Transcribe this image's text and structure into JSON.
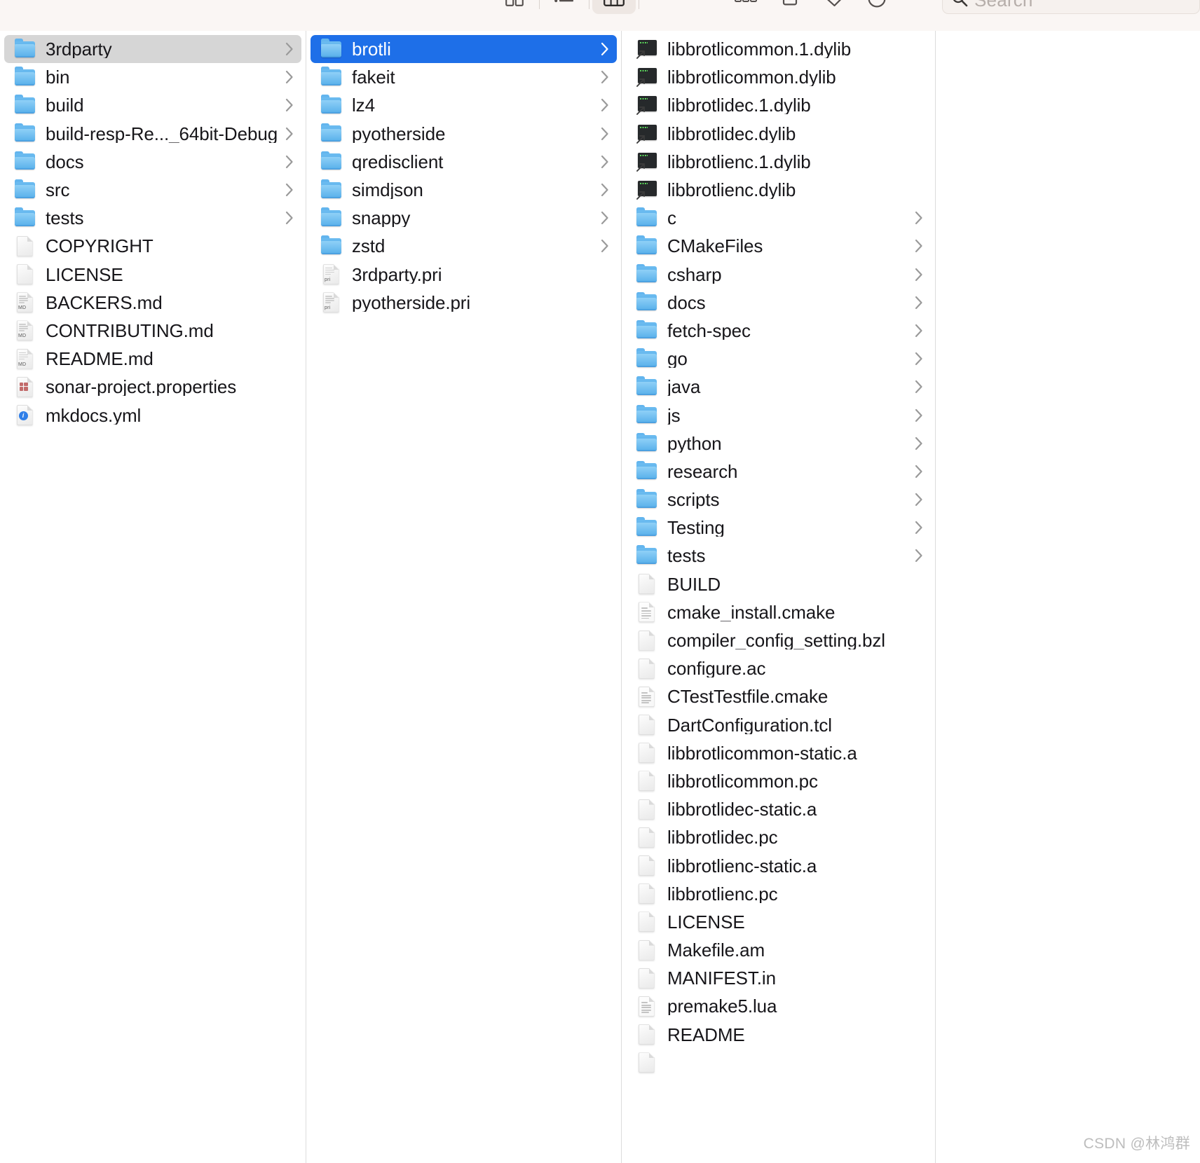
{
  "toolbar": {
    "buttons": [
      {
        "name": "icon-view-button",
        "icon": "grid-icon",
        "active": false
      },
      {
        "name": "list-view-button",
        "icon": "list-icon",
        "active": false
      },
      {
        "name": "column-view-button",
        "icon": "columns-icon",
        "active": true
      },
      {
        "name": "gallery-view-button",
        "icon": "gallery-icon",
        "active": false
      },
      {
        "name": "group-by-button",
        "icon": "group-icon",
        "active": false
      },
      {
        "name": "share-button",
        "icon": "share-icon",
        "active": false
      },
      {
        "name": "tags-button",
        "icon": "tag-icon",
        "active": false
      },
      {
        "name": "action-button",
        "icon": "more-circle-icon",
        "active": false
      }
    ],
    "search": {
      "placeholder": "Search",
      "value": "",
      "icon": "search-icon"
    }
  },
  "columns": [
    {
      "name": "column-1",
      "items": [
        {
          "label": "3rdparty",
          "icon": "folder",
          "chevron": true,
          "selected": "gray"
        },
        {
          "label": "bin",
          "icon": "folder",
          "chevron": true
        },
        {
          "label": "build",
          "icon": "folder",
          "chevron": true
        },
        {
          "label": "build-resp-Re..._64bit-Debug",
          "icon": "folder",
          "chevron": true
        },
        {
          "label": "docs",
          "icon": "folder",
          "chevron": true
        },
        {
          "label": "src",
          "icon": "folder",
          "chevron": true
        },
        {
          "label": "tests",
          "icon": "folder",
          "chevron": true
        },
        {
          "label": "COPYRIGHT",
          "icon": "doc-plain",
          "chevron": false
        },
        {
          "label": "LICENSE",
          "icon": "doc-plain",
          "chevron": false
        },
        {
          "label": "BACKERS.md",
          "icon": "doc-md",
          "chevron": false
        },
        {
          "label": "CONTRIBUTING.md",
          "icon": "doc-md",
          "chevron": false
        },
        {
          "label": "README.md",
          "icon": "doc-md",
          "chevron": false
        },
        {
          "label": "sonar-project.properties",
          "icon": "doc-properties",
          "chevron": false
        },
        {
          "label": "mkdocs.yml",
          "icon": "doc-yml",
          "chevron": false
        }
      ]
    },
    {
      "name": "column-2",
      "items": [
        {
          "label": "brotli",
          "icon": "folder",
          "chevron": true,
          "selected": "blue"
        },
        {
          "label": "fakeit",
          "icon": "folder",
          "chevron": true
        },
        {
          "label": "lz4",
          "icon": "folder",
          "chevron": true
        },
        {
          "label": "pyotherside",
          "icon": "folder",
          "chevron": true
        },
        {
          "label": "qredisclient",
          "icon": "folder",
          "chevron": true
        },
        {
          "label": "simdjson",
          "icon": "folder",
          "chevron": true
        },
        {
          "label": "snappy",
          "icon": "folder",
          "chevron": true
        },
        {
          "label": "zstd",
          "icon": "folder",
          "chevron": true
        },
        {
          "label": "3rdparty.pri",
          "icon": "doc-pri",
          "chevron": false
        },
        {
          "label": "pyotherside.pri",
          "icon": "doc-pri",
          "chevron": false
        }
      ]
    },
    {
      "name": "column-3",
      "items": [
        {
          "label": "libbrotlicommon.1.dylib",
          "icon": "exec-alias",
          "chevron": false
        },
        {
          "label": "libbrotlicommon.dylib",
          "icon": "exec-alias",
          "chevron": false
        },
        {
          "label": "libbrotlidec.1.dylib",
          "icon": "exec-alias",
          "chevron": false
        },
        {
          "label": "libbrotlidec.dylib",
          "icon": "exec-alias",
          "chevron": false
        },
        {
          "label": "libbrotlienc.1.dylib",
          "icon": "exec-alias",
          "chevron": false
        },
        {
          "label": "libbrotlienc.dylib",
          "icon": "exec-alias",
          "chevron": false
        },
        {
          "label": "c",
          "icon": "folder",
          "chevron": true
        },
        {
          "label": "CMakeFiles",
          "icon": "folder",
          "chevron": true
        },
        {
          "label": "csharp",
          "icon": "folder",
          "chevron": true
        },
        {
          "label": "docs",
          "icon": "folder",
          "chevron": true
        },
        {
          "label": "fetch-spec",
          "icon": "folder",
          "chevron": true
        },
        {
          "label": "go",
          "icon": "folder",
          "chevron": true
        },
        {
          "label": "java",
          "icon": "folder",
          "chevron": true
        },
        {
          "label": "js",
          "icon": "folder",
          "chevron": true
        },
        {
          "label": "python",
          "icon": "folder",
          "chevron": true
        },
        {
          "label": "research",
          "icon": "folder",
          "chevron": true
        },
        {
          "label": "scripts",
          "icon": "folder",
          "chevron": true
        },
        {
          "label": "Testing",
          "icon": "folder",
          "chevron": true
        },
        {
          "label": "tests",
          "icon": "folder",
          "chevron": true
        },
        {
          "label": "BUILD",
          "icon": "doc-plain",
          "chevron": false
        },
        {
          "label": "cmake_install.cmake",
          "icon": "doc-lines",
          "chevron": false
        },
        {
          "label": "compiler_config_setting.bzl",
          "icon": "doc-plain",
          "chevron": false
        },
        {
          "label": "configure.ac",
          "icon": "doc-plain",
          "chevron": false
        },
        {
          "label": "CTestTestfile.cmake",
          "icon": "doc-lines",
          "chevron": false
        },
        {
          "label": "DartConfiguration.tcl",
          "icon": "doc-plain",
          "chevron": false
        },
        {
          "label": "libbrotlicommon-static.a",
          "icon": "doc-plain",
          "chevron": false
        },
        {
          "label": "libbrotlicommon.pc",
          "icon": "doc-plain",
          "chevron": false
        },
        {
          "label": "libbrotlidec-static.a",
          "icon": "doc-plain",
          "chevron": false
        },
        {
          "label": "libbrotlidec.pc",
          "icon": "doc-plain",
          "chevron": false
        },
        {
          "label": "libbrotlienc-static.a",
          "icon": "doc-plain",
          "chevron": false
        },
        {
          "label": "libbrotlienc.pc",
          "icon": "doc-plain",
          "chevron": false
        },
        {
          "label": "LICENSE",
          "icon": "doc-plain",
          "chevron": false
        },
        {
          "label": "Makefile.am",
          "icon": "doc-plain",
          "chevron": false
        },
        {
          "label": "MANIFEST.in",
          "icon": "doc-plain",
          "chevron": false
        },
        {
          "label": "premake5.lua",
          "icon": "doc-lines",
          "chevron": false
        },
        {
          "label": "README",
          "icon": "doc-plain",
          "chevron": false
        },
        {
          "label": "",
          "icon": "doc-plain",
          "chevron": false
        }
      ]
    },
    {
      "name": "column-4",
      "items": []
    }
  ],
  "watermark": "CSDN @林鸿群",
  "colors": {
    "selection_blue": "#1e6fe8",
    "selection_gray": "#d6d6d6",
    "folder_blue": "#5fb4ec",
    "toolbar_bg": "#faf6f4",
    "text": "#17161a"
  }
}
